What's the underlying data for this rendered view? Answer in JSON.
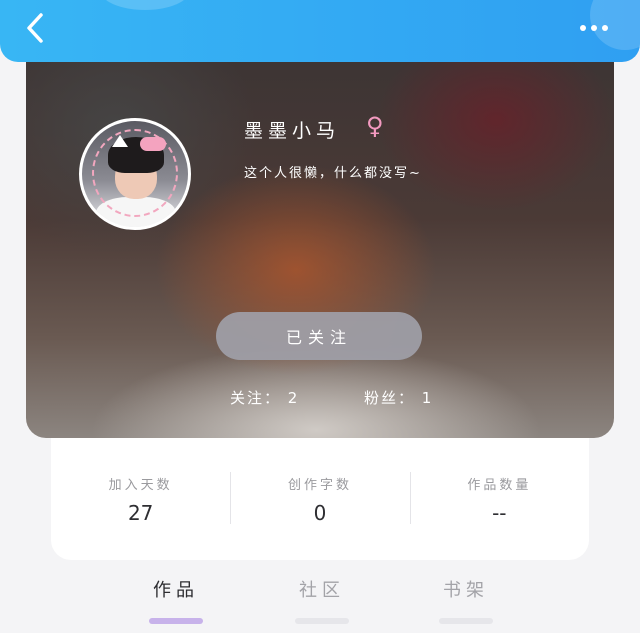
{
  "header": {
    "back_icon": "chevron-left-icon",
    "more_icon": "more-dots-icon",
    "accent_color": "#2fa8f3"
  },
  "profile": {
    "nickname": "墨墨小马",
    "gender_symbol": "♀",
    "gender_color": "#f39ac0",
    "bio": "这个人很懒，什么都没写~",
    "follow_button_label": "已关注",
    "following_text": "关注： 2",
    "fans_text": "粉丝： 1"
  },
  "stats": [
    {
      "label": "加入天数",
      "value": "27"
    },
    {
      "label": "创作字数",
      "value": "0"
    },
    {
      "label": "作品数量",
      "value": "--"
    }
  ],
  "tabs": [
    {
      "label": "作品",
      "active": true
    },
    {
      "label": "社区",
      "active": false
    },
    {
      "label": "书架",
      "active": false
    }
  ],
  "tab_indicator_color": "#c7b2ea"
}
